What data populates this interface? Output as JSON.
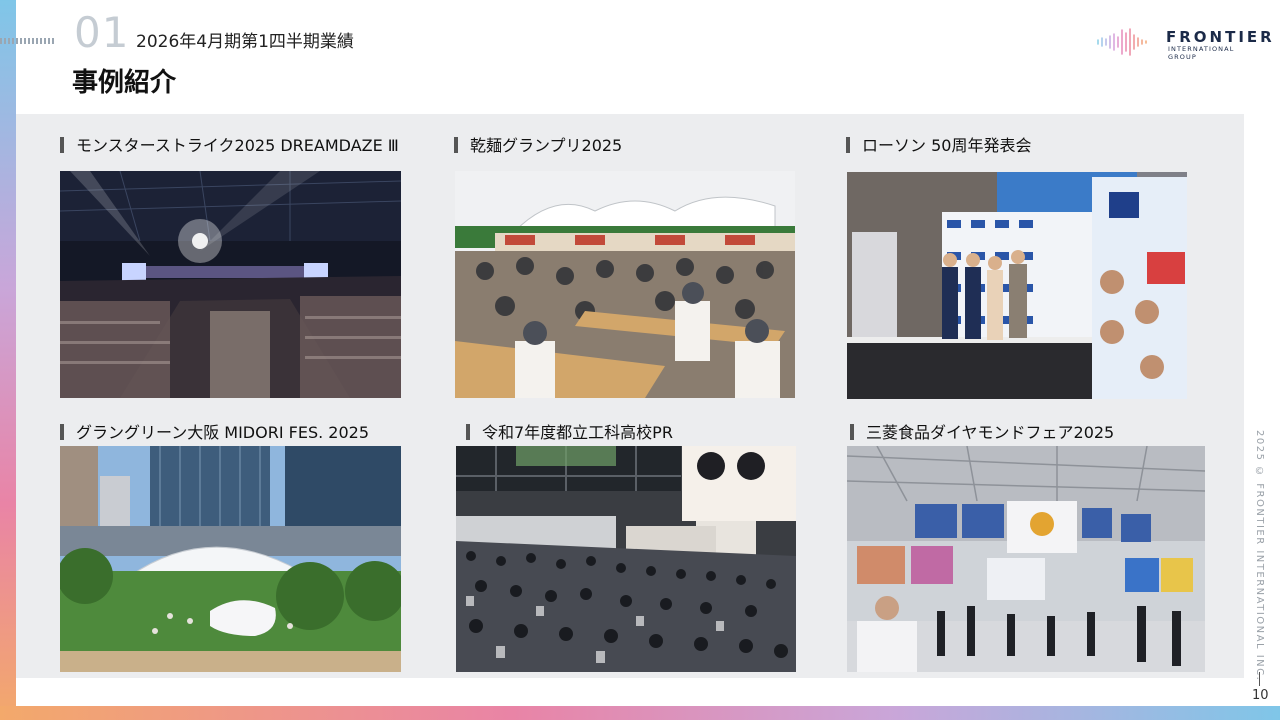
{
  "header": {
    "section_number": "01",
    "subtitle": "2026年4月期第1四半期業績",
    "title": "事例紹介"
  },
  "logo": {
    "main": "FRONTIER",
    "sub": "INTERNATIONAL GROUP"
  },
  "cases": [
    {
      "caption": "モンスターストライク2025 DREAMDAZE Ⅲ",
      "image": "arena-concert"
    },
    {
      "caption": "乾麺グランプリ2025",
      "image": "outdoor-food-festival"
    },
    {
      "caption": "ローソン 50周年発表会",
      "image": "press-conference-stage"
    },
    {
      "caption": "グラングリーン大阪 MIDORI FES. 2025",
      "image": "urban-park-event"
    },
    {
      "caption": "令和7年度都立工科高校PR",
      "image": "indoor-crowd-exhibition"
    },
    {
      "caption": "三菱食品ダイヤモンドフェア2025",
      "image": "trade-show-hall"
    }
  ],
  "footer": {
    "copyright": "2025 © FRONTIER INTERNATIONAL INC.",
    "page_number": "10"
  }
}
